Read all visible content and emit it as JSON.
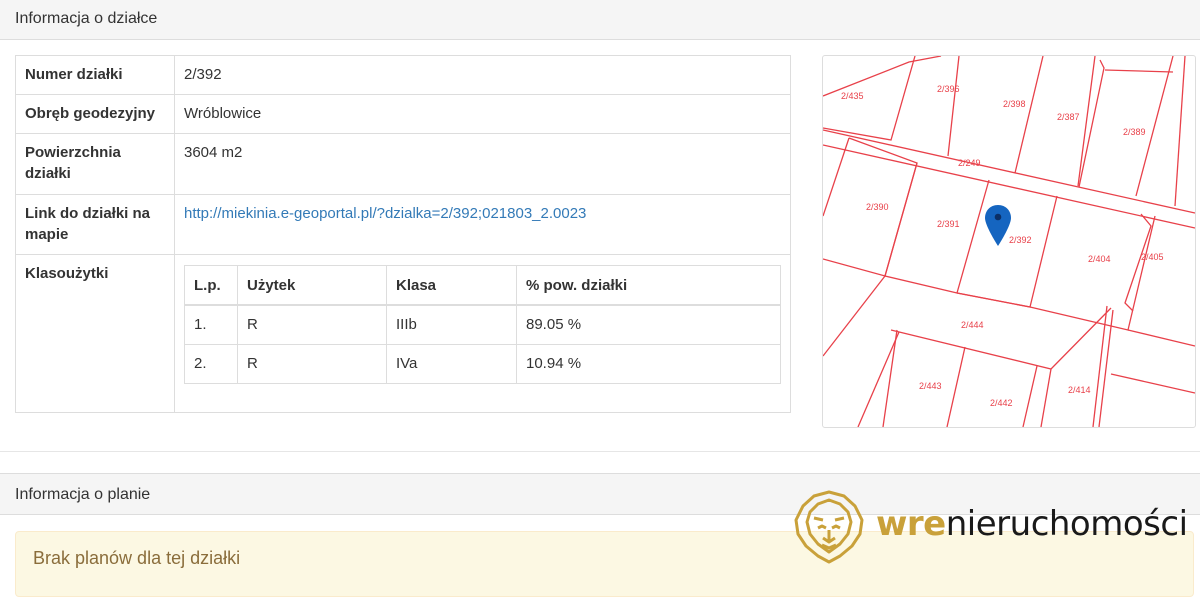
{
  "header1": "Informacja o działce",
  "header2": "Informacja o planie",
  "info": {
    "numer_label": "Numer działki",
    "numer_value": "2/392",
    "obreb_label": "Obręb geodezyjny",
    "obreb_value": "Wróblowice",
    "pow_label": "Powierzchnia działki",
    "pow_value": "3604 m2",
    "link_label": "Link do działki na mapie",
    "link_value": "http://miekinia.e-geoportal.pl/?dzialka=2/392;021803_2.0023",
    "klaso_label": "Klasoużytki"
  },
  "uzytki": {
    "headers": [
      "L.p.",
      "Użytek",
      "Klasa",
      "% pow. działki"
    ],
    "rows": [
      [
        "1.",
        "R",
        "IIIb",
        "89.05 %"
      ],
      [
        "2.",
        "R",
        "IVa",
        "10.94 %"
      ]
    ]
  },
  "map": {
    "parcel_labels": [
      "2/435",
      "2/396",
      "2/398",
      "2/387",
      "2/389",
      "2/249",
      "2/390",
      "2/391",
      "2/392",
      "2/404",
      "2/405",
      "2/444",
      "2/443",
      "2/442",
      "2/414"
    ],
    "line_color": "#e8414a",
    "marker_color": "#1565c0"
  },
  "alert": "Brak planów dla tej działki",
  "logo": {
    "part1": "wre",
    "part2": "nieruchomości",
    "brand_color": "#c9a13a"
  }
}
